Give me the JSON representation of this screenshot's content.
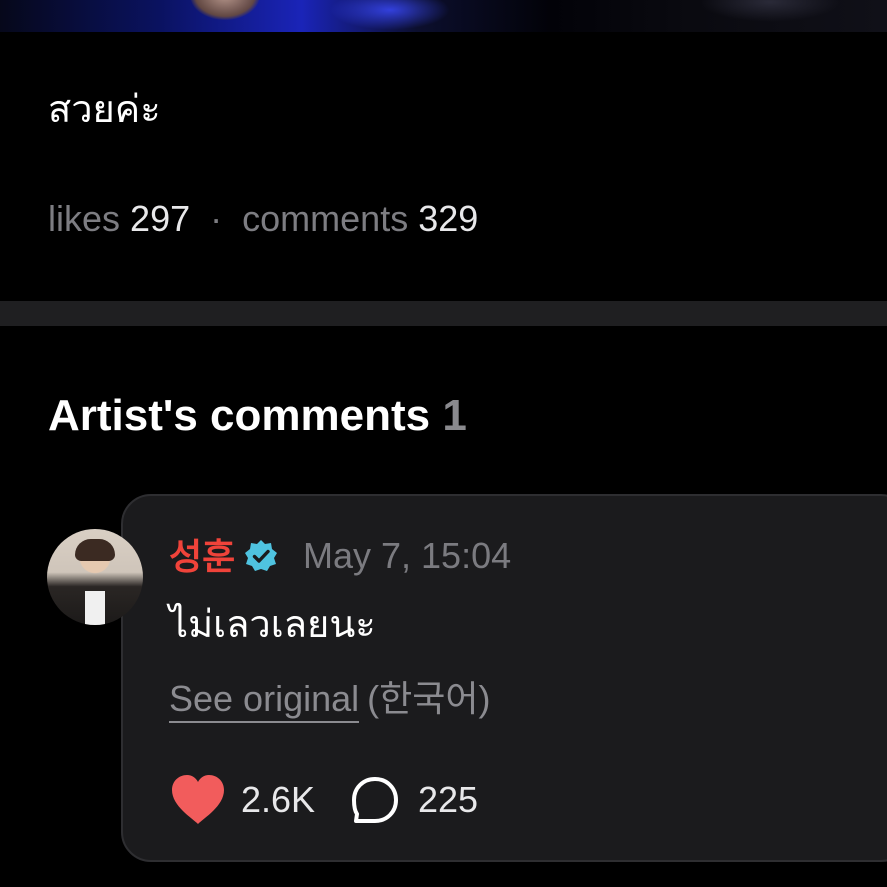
{
  "post": {
    "text": "สวยค่ะ",
    "likes_label": "likes",
    "likes_count": "297",
    "separator": "·",
    "comments_label": "comments",
    "comments_count": "329"
  },
  "artist_comments": {
    "title": "Artist's comments",
    "count": "1",
    "comment": {
      "author": "성훈",
      "verified_icon": "verified-badge-icon",
      "time": "May 7, 15:04",
      "text": "ไม่เลวเลยนะ",
      "see_original": "See original",
      "original_lang": "(한국어)",
      "likes": "2.6K",
      "replies": "225"
    }
  },
  "colors": {
    "author": "#f0433a",
    "heart": "#f25c5c",
    "verified": "#4fc3e0",
    "card_bg": "#1b1b1d"
  }
}
